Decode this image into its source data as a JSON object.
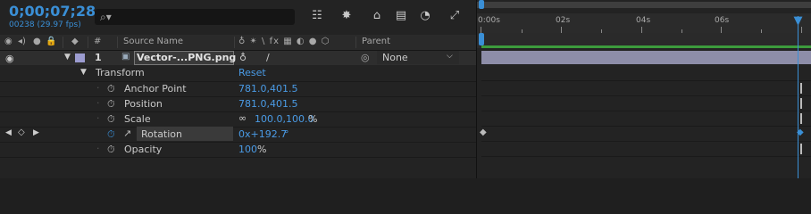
{
  "header": {
    "timecode": "0;00;07;28",
    "frame_info": "00238 (29.97 fps)",
    "search_placeholder": ""
  },
  "columns": {
    "num": "#",
    "source_name": "Source Name",
    "switches": "♁ ✴ \\ fx ▦ ◐ ● ⬡",
    "parent": "Parent"
  },
  "layer": {
    "index": "1",
    "name": "Vector-...PNG.png",
    "parent_value": "None",
    "color": "#9c9cd0"
  },
  "transform": {
    "label": "Transform",
    "reset": "Reset",
    "properties": [
      {
        "name": "Anchor Point",
        "value": "781.0,401.5"
      },
      {
        "name": "Position",
        "value": "781.0,401.5"
      },
      {
        "name": "Scale",
        "value": "100.0,100.0",
        "unit": "%"
      },
      {
        "name": "Rotation",
        "value": "0x+192.7",
        "unit": "°"
      },
      {
        "name": "Opacity",
        "value": "100",
        "unit": "%"
      }
    ]
  },
  "timeline": {
    "ticks": [
      "0:00s",
      "02s",
      "04s",
      "06s"
    ]
  },
  "colors": {
    "accent": "#3a8fd6",
    "value": "#4a9be6",
    "work_area": "#3c9b3c"
  }
}
